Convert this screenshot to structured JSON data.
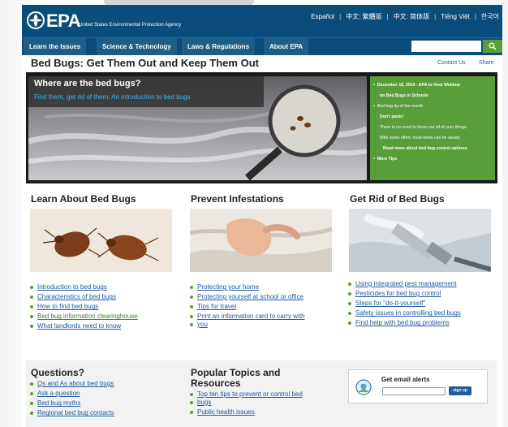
{
  "header": {
    "logo_text": "EPA",
    "agency": "United States Environmental Protection Agency",
    "languages": [
      "Español",
      "中文: 繁體版",
      "中文: 简体版",
      "Tiếng Việt",
      "한국어"
    ]
  },
  "nav": {
    "items": [
      "Learn the Issues",
      "Science & Technology",
      "Laws & Regulations",
      "About EPA"
    ],
    "search_icon": "search-icon"
  },
  "page": {
    "title": "Bed Bugs: Get Them Out and Keep Them Out",
    "contact": "Contact Us",
    "share": "Share"
  },
  "hero": {
    "title": "Where are the bed bugs?",
    "subtitle": "Find them, get rid of them: An introduction to bed bugs"
  },
  "news": {
    "items": [
      "December 16, 2014 - EPA to Host Webinar",
      "on Bed Bugs in Schools",
      "Bed bug tip of the month",
      "Don't panic!",
      "There is no need to throw out all of your things.",
      "With some effort, most items can be saved.",
      "Read more about bed bug control options.",
      "More Tips"
    ]
  },
  "columns": [
    {
      "heading": "Learn About Bed Bugs",
      "links": [
        "Introduction to bed bugs",
        "Characteristics of bed bugs",
        "How to find bed bugs",
        "Bed bug information clearinghouse",
        "What landlords need to know"
      ]
    },
    {
      "heading": "Prevent Infestations",
      "links": [
        "Protecting your home",
        "Protecting yourself at school or office",
        "Tips for travel",
        "Print an information card to carry with",
        "you"
      ]
    },
    {
      "heading": "Get Rid of Bed Bugs",
      "links": [
        "Using integrated pest management",
        "Pesticides for bed bug control",
        "Steps for \"do-it-yourself\"",
        "Safety issues in controlling bed bugs",
        "Find help with bed bug problems"
      ]
    }
  ],
  "bottom": {
    "questions": {
      "heading": "Questions?",
      "links": [
        "Qs and As about bed bugs",
        "Ask a question",
        "Bed bug myths",
        "Regional bed bug contacts"
      ]
    },
    "popular": {
      "heading_line1": "Popular Topics and",
      "heading_line2": "Resources",
      "links": [
        "Top ten tips to prevent or control bed",
        "bugs",
        "Public health issues"
      ]
    },
    "alerts": {
      "label": "Get email alerts",
      "button": "sign up"
    }
  }
}
